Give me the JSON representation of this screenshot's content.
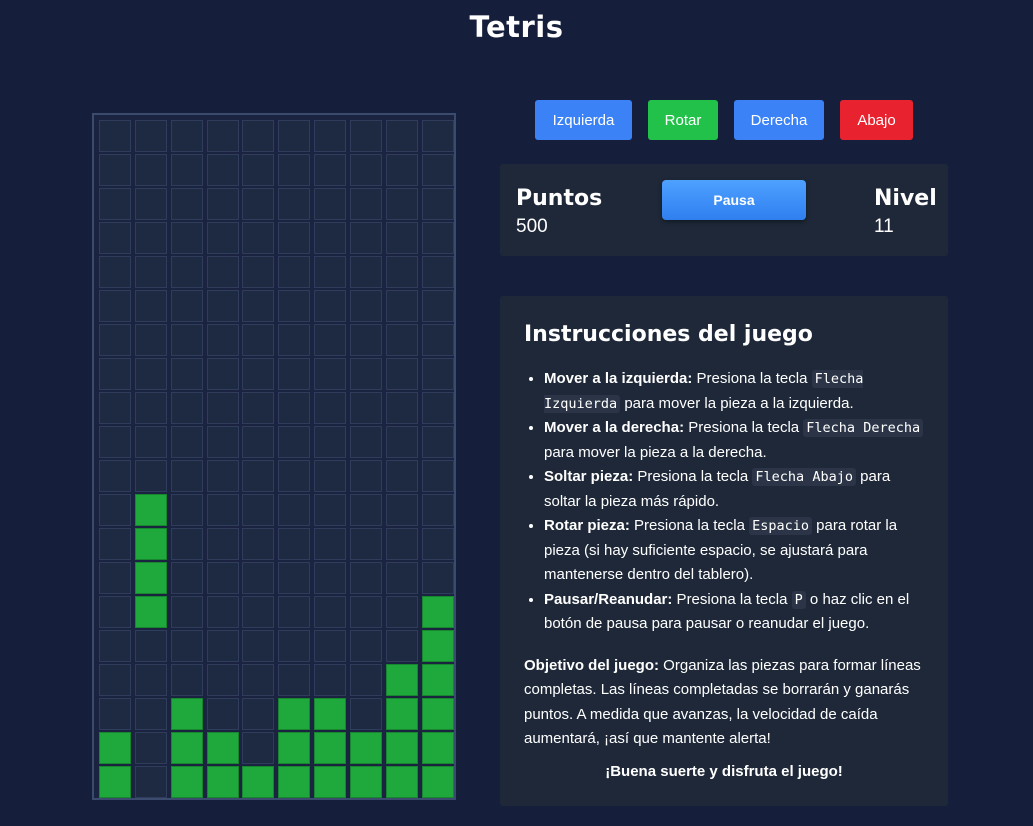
{
  "header": {
    "title": "Tetris"
  },
  "controls": {
    "left": "Izquierda",
    "rotate": "Rotar",
    "right": "Derecha",
    "down": "Abajo"
  },
  "stats": {
    "points_label": "Puntos",
    "points_value": "500",
    "pause_label": "Pausa",
    "level_label": "Nivel",
    "level_value": "11"
  },
  "board": {
    "columns": 10,
    "rows": 20,
    "filled_color": "#1fa83c",
    "grid": [
      "..........",
      "..........",
      "..........",
      "..........",
      "..........",
      "..........",
      "..........",
      "..........",
      "..........",
      "..........",
      "..........",
      ".#........",
      ".#........",
      ".#........",
      ".#.......#",
      ".........#",
      "........##",
      "..#..##.##",
      "#.##.#####",
      "#.########"
    ]
  },
  "instructions": {
    "title": "Instrucciones del juego",
    "items": [
      {
        "label": "Mover a la izquierda:",
        "pre": " Presiona la tecla ",
        "key": "Flecha Izquierda",
        "post": " para mover la pieza a la izquierda."
      },
      {
        "label": "Mover a la derecha:",
        "pre": " Presiona la tecla ",
        "key": "Flecha Derecha",
        "post": " para mover la pieza a la derecha."
      },
      {
        "label": "Soltar pieza:",
        "pre": " Presiona la tecla ",
        "key": "Flecha Abajo",
        "post": " para soltar la pieza más rápido."
      },
      {
        "label": "Rotar pieza:",
        "pre": " Presiona la tecla ",
        "key": "Espacio",
        "post": " para rotar la pieza (si hay suficiente espacio, se ajustará para mantenerse dentro del tablero)."
      },
      {
        "label": "Pausar/Reanudar:",
        "pre": " Presiona la tecla ",
        "key": "P",
        "post": " o haz clic en el botón de pausa para pausar o reanudar el juego."
      }
    ],
    "objective_label": "Objetivo del juego:",
    "objective_text": " Organiza las piezas para formar líneas completas. Las líneas completadas se borrarán y ganarás puntos. A medida que avanzas, la velocidad de caída aumentará, ¡así que mantente alerta!",
    "good_luck": "¡Buena suerte y disfruta el juego!"
  }
}
